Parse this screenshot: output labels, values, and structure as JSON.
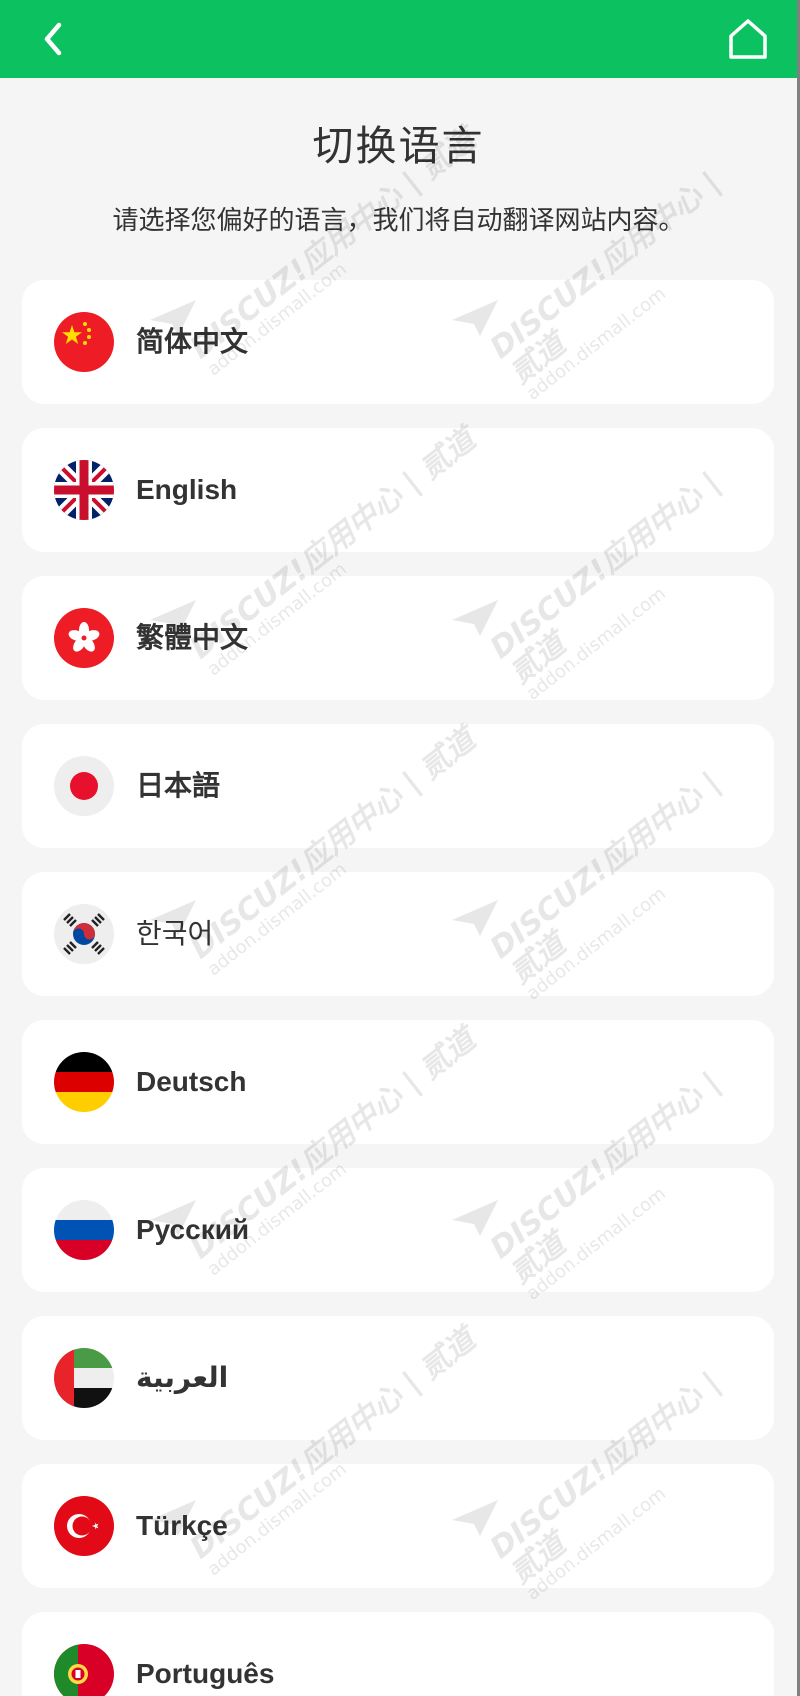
{
  "header": {
    "back_icon": "chevron-left-icon",
    "home_icon": "home-icon",
    "bar_color": "#0bc160"
  },
  "page": {
    "title": "切换语言",
    "subtitle": "请选择您偏好的语言，我们将自动翻译网站内容。"
  },
  "languages": [
    {
      "label": "简体中文",
      "flag": "china-flag-icon"
    },
    {
      "label": "English",
      "flag": "uk-flag-icon"
    },
    {
      "label": "繁體中文",
      "flag": "hong-kong-flag-icon"
    },
    {
      "label": "日本語",
      "flag": "japan-flag-icon"
    },
    {
      "label": "한국어",
      "flag": "korea-flag-icon"
    },
    {
      "label": "Deutsch",
      "flag": "germany-flag-icon"
    },
    {
      "label": "Русский",
      "flag": "russia-flag-icon"
    },
    {
      "label": "العربية",
      "flag": "uae-flag-icon"
    },
    {
      "label": "Türkçe",
      "flag": "turkey-flag-icon"
    },
    {
      "label": "Português",
      "flag": "portugal-flag-icon"
    }
  ],
  "watermark": {
    "line1": "DISCUZ!应用中心 | 贰道",
    "line2": "addon.dismall.com"
  }
}
